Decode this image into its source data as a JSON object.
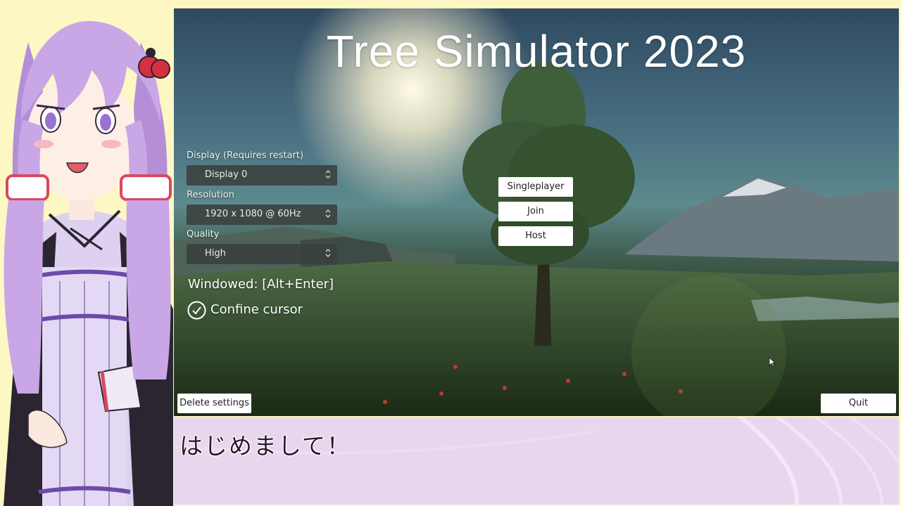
{
  "game": {
    "title": "Tree Simulator 2023",
    "display_label": "Display (Requires restart)",
    "display_value": "Display 0",
    "resolution_label": "Resolution",
    "resolution_value": "1920 x 1080 @ 60Hz",
    "quality_label": "Quality",
    "quality_value": "High",
    "windowed_text": "Windowed: [Alt+Enter]",
    "confine_cursor_label": "Confine cursor",
    "confine_cursor_checked": true,
    "singleplayer_label": "Singleplayer",
    "join_label": "Join",
    "host_label": "Host",
    "delete_settings_label": "Delete settings",
    "quit_label": "Quit"
  },
  "subtitle": {
    "text": "はじめまして！"
  },
  "colors": {
    "page_background": "#fdf7c4",
    "subtitle_background": "#e8d6ee",
    "character_hair": "#c9a6e6",
    "button_background": "#ffffff"
  }
}
